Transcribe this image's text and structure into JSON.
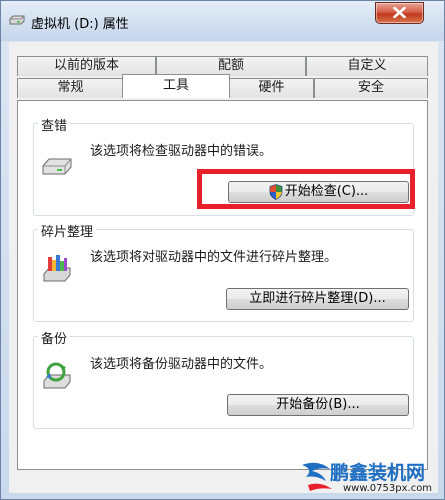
{
  "window": {
    "title": "虚拟机 (D:) 属性",
    "close_icon": "close-icon"
  },
  "tabs": {
    "row_back": [
      {
        "label": "以前的版本"
      },
      {
        "label": "配额"
      },
      {
        "label": "自定义"
      }
    ],
    "row_front": [
      {
        "label": "常规"
      },
      {
        "label": "工具",
        "selected": true
      },
      {
        "label": "硬件"
      },
      {
        "label": "安全"
      }
    ]
  },
  "groups": {
    "error_check": {
      "title": "查错",
      "description": "该选项将检查驱动器中的错误。",
      "button_label": "开始检查(C)...",
      "icon": "drive-icon"
    },
    "defrag": {
      "title": "碎片整理",
      "description": "该选项将对驱动器中的文件进行碎片整理。",
      "button_label": "立即进行碎片整理(D)...",
      "icon": "defrag-icon"
    },
    "backup": {
      "title": "备份",
      "description": "该选项将备份驱动器中的文件。",
      "button_label": "开始备份(B)...",
      "icon": "backup-icon"
    }
  },
  "watermark": {
    "brand": "鹏鑫装机网",
    "url": "www.0753px.com"
  },
  "colors": {
    "highlight": "#e8202a",
    "titlebar": "#d0deef",
    "close_button": "#c1381d"
  }
}
